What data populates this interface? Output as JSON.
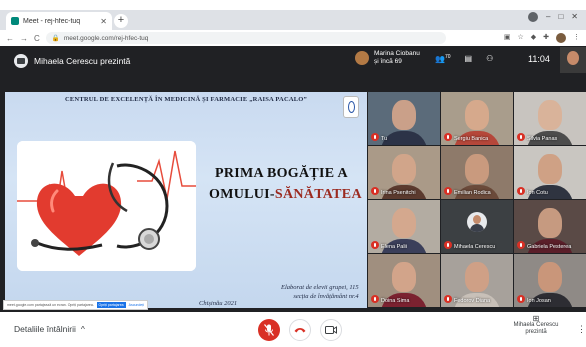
{
  "browser": {
    "tab_title": "Meet - rej-hfec-tuq",
    "tab_close": "✕",
    "new_tab": "+",
    "url": "meet.google.com/rej-hfec-tuq",
    "back": "←",
    "forward": "→",
    "reload": "C"
  },
  "header": {
    "presenter_text": "Mihaela Cerescu prezintă",
    "participants_name": "Marina Ciobanu",
    "participants_more": "și încă 69",
    "participants_count": "70",
    "time": "11:04"
  },
  "slide": {
    "institution": "CENTRUL DE EXCELENȚĂ ÎN MEDICINĂ ȘI FARMACIE „RAISA PACALO”",
    "title_line1": "PRIMA BOGĂȚIE A",
    "title_line2_prefix": "OMULUI-",
    "title_line2_accent": "SĂNĂTATEA",
    "author_line1": "Elaborat de elevii grupei, 115",
    "author_line2": "secția de învățământ nr.4",
    "city": "Chișinău 2021"
  },
  "share_bar": {
    "text": "meet.google.com partajează un ecran. Opriți partajarea Ascundeți",
    "stop_label": "Opriți partajarea",
    "hide_label": "Ascundeți"
  },
  "participants": [
    {
      "name": "Tu",
      "skin": "#caa089",
      "shirt": "#2c3347",
      "bg": "#5b6b7a"
    },
    {
      "name": "Sergiu Banica",
      "skin": "#d6a98c",
      "shirt": "#b5473a",
      "bg": "#a99d8c"
    },
    {
      "name": "Silvia Panas",
      "skin": "#d9b39a",
      "shirt": "#4c4c4c",
      "bg": "#c8c4bf"
    },
    {
      "name": "Irina Psenitchi",
      "skin": "#d1a58a",
      "shirt": "#5b3a2e",
      "bg": "#aa9a88"
    },
    {
      "name": "Emilian Rodica",
      "skin": "#c99a7e",
      "shirt": "#6b4a3a",
      "bg": "#8e7a6a"
    },
    {
      "name": "Ion Cotu",
      "skin": "#cfa185",
      "shirt": "#2f3440",
      "bg": "#c9c6c1"
    },
    {
      "name": "Elena Palii",
      "skin": "#d4a88e",
      "shirt": "#3b3f5a",
      "bg": "#b3aca2"
    },
    {
      "name": "Mihaela Cerescu",
      "skin": "#c38b6c",
      "shirt": "#3a3f4a",
      "bg": "#3c4043",
      "avatar": true
    },
    {
      "name": "Gabriela Pesterea",
      "skin": "#c69a80",
      "shirt": "#5b1f2a",
      "bg": "#5a4a46"
    },
    {
      "name": "Doina Sima",
      "skin": "#d2a48a",
      "shirt": "#7b2230",
      "bg": "#a08f7f"
    },
    {
      "name": "Fedorov Diana",
      "skin": "#cfa086",
      "shirt": "#c8c0b8",
      "bg": "#a7a19b"
    },
    {
      "name": "Ion Josan",
      "skin": "#c9967a",
      "shirt": "#2d2d33",
      "bg": "#8f8a86"
    }
  ],
  "bottom": {
    "details_label": "Detaliile întâlnirii",
    "chevron": "^",
    "presenting_name": "Mihaela Cerescu",
    "presenting_label": "prezintă",
    "more": "⋮"
  },
  "icons": {
    "mic_off": "mic-off-icon",
    "hang_up": "call-end-icon",
    "camera": "videocam-icon"
  }
}
